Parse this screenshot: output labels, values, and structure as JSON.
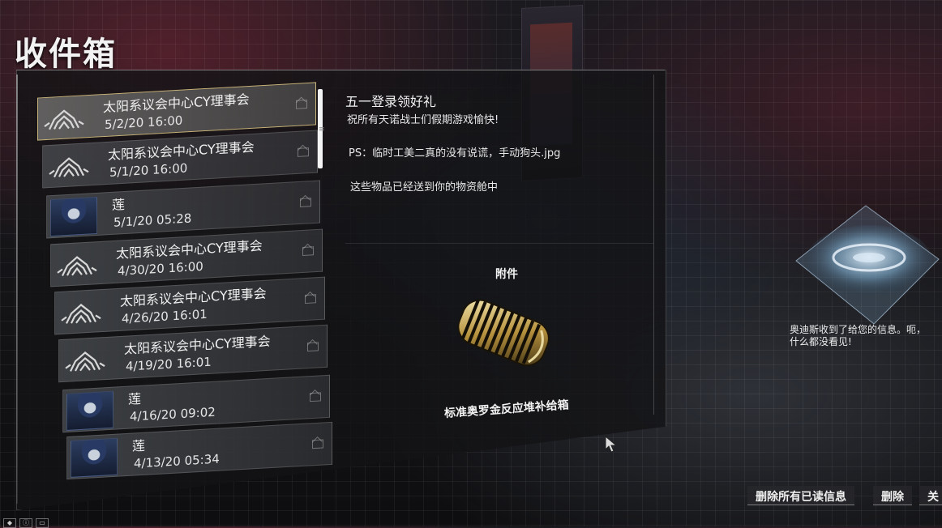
{
  "page": {
    "title": "收件箱"
  },
  "mail_list": [
    {
      "sender": "太阳系议会中心CY理事会",
      "date": "5/2/20 16:00",
      "avatar": "warframe-logo-icon",
      "selected": true
    },
    {
      "sender": "太阳系议会中心CY理事会",
      "date": "5/1/20 16:00",
      "avatar": "warframe-logo-icon"
    },
    {
      "sender": "莲",
      "date": "5/1/20 05:28",
      "avatar": "lotus-portrait"
    },
    {
      "sender": "太阳系议会中心CY理事会",
      "date": "4/30/20 16:00",
      "avatar": "warframe-logo-icon"
    },
    {
      "sender": "太阳系议会中心CY理事会",
      "date": "4/26/20 16:01",
      "avatar": "warframe-logo-icon"
    },
    {
      "sender": "太阳系议会中心CY理事会",
      "date": "4/19/20 16:01",
      "avatar": "warframe-logo-icon"
    },
    {
      "sender": "莲",
      "date": "4/16/20 09:02",
      "avatar": "lotus-portrait"
    },
    {
      "sender": "莲",
      "date": "4/13/20 05:34",
      "avatar": "lotus-portrait"
    }
  ],
  "message": {
    "subject": "五一登录领好礼",
    "lines": [
      "祝所有天诺战士们假期游戏愉快!",
      "PS：临时工美二真的没有说谎，手动狗头.jpg",
      "这些物品已经送到你的物资舱中"
    ],
    "attachment_label": "附件",
    "attachment_item": "标准奥罗金反应堆补给箱"
  },
  "ordis": {
    "lines": [
      "奥迪斯收到了给您的信息。呃，",
      "什么都没看见!"
    ]
  },
  "buttons": {
    "delete_all_read": "删除所有已读信息",
    "delete": "删除",
    "close": "关"
  },
  "colors": {
    "selected_border": "#c6b37a",
    "panel_bg": "#141416",
    "text": "#f0f0f0"
  }
}
